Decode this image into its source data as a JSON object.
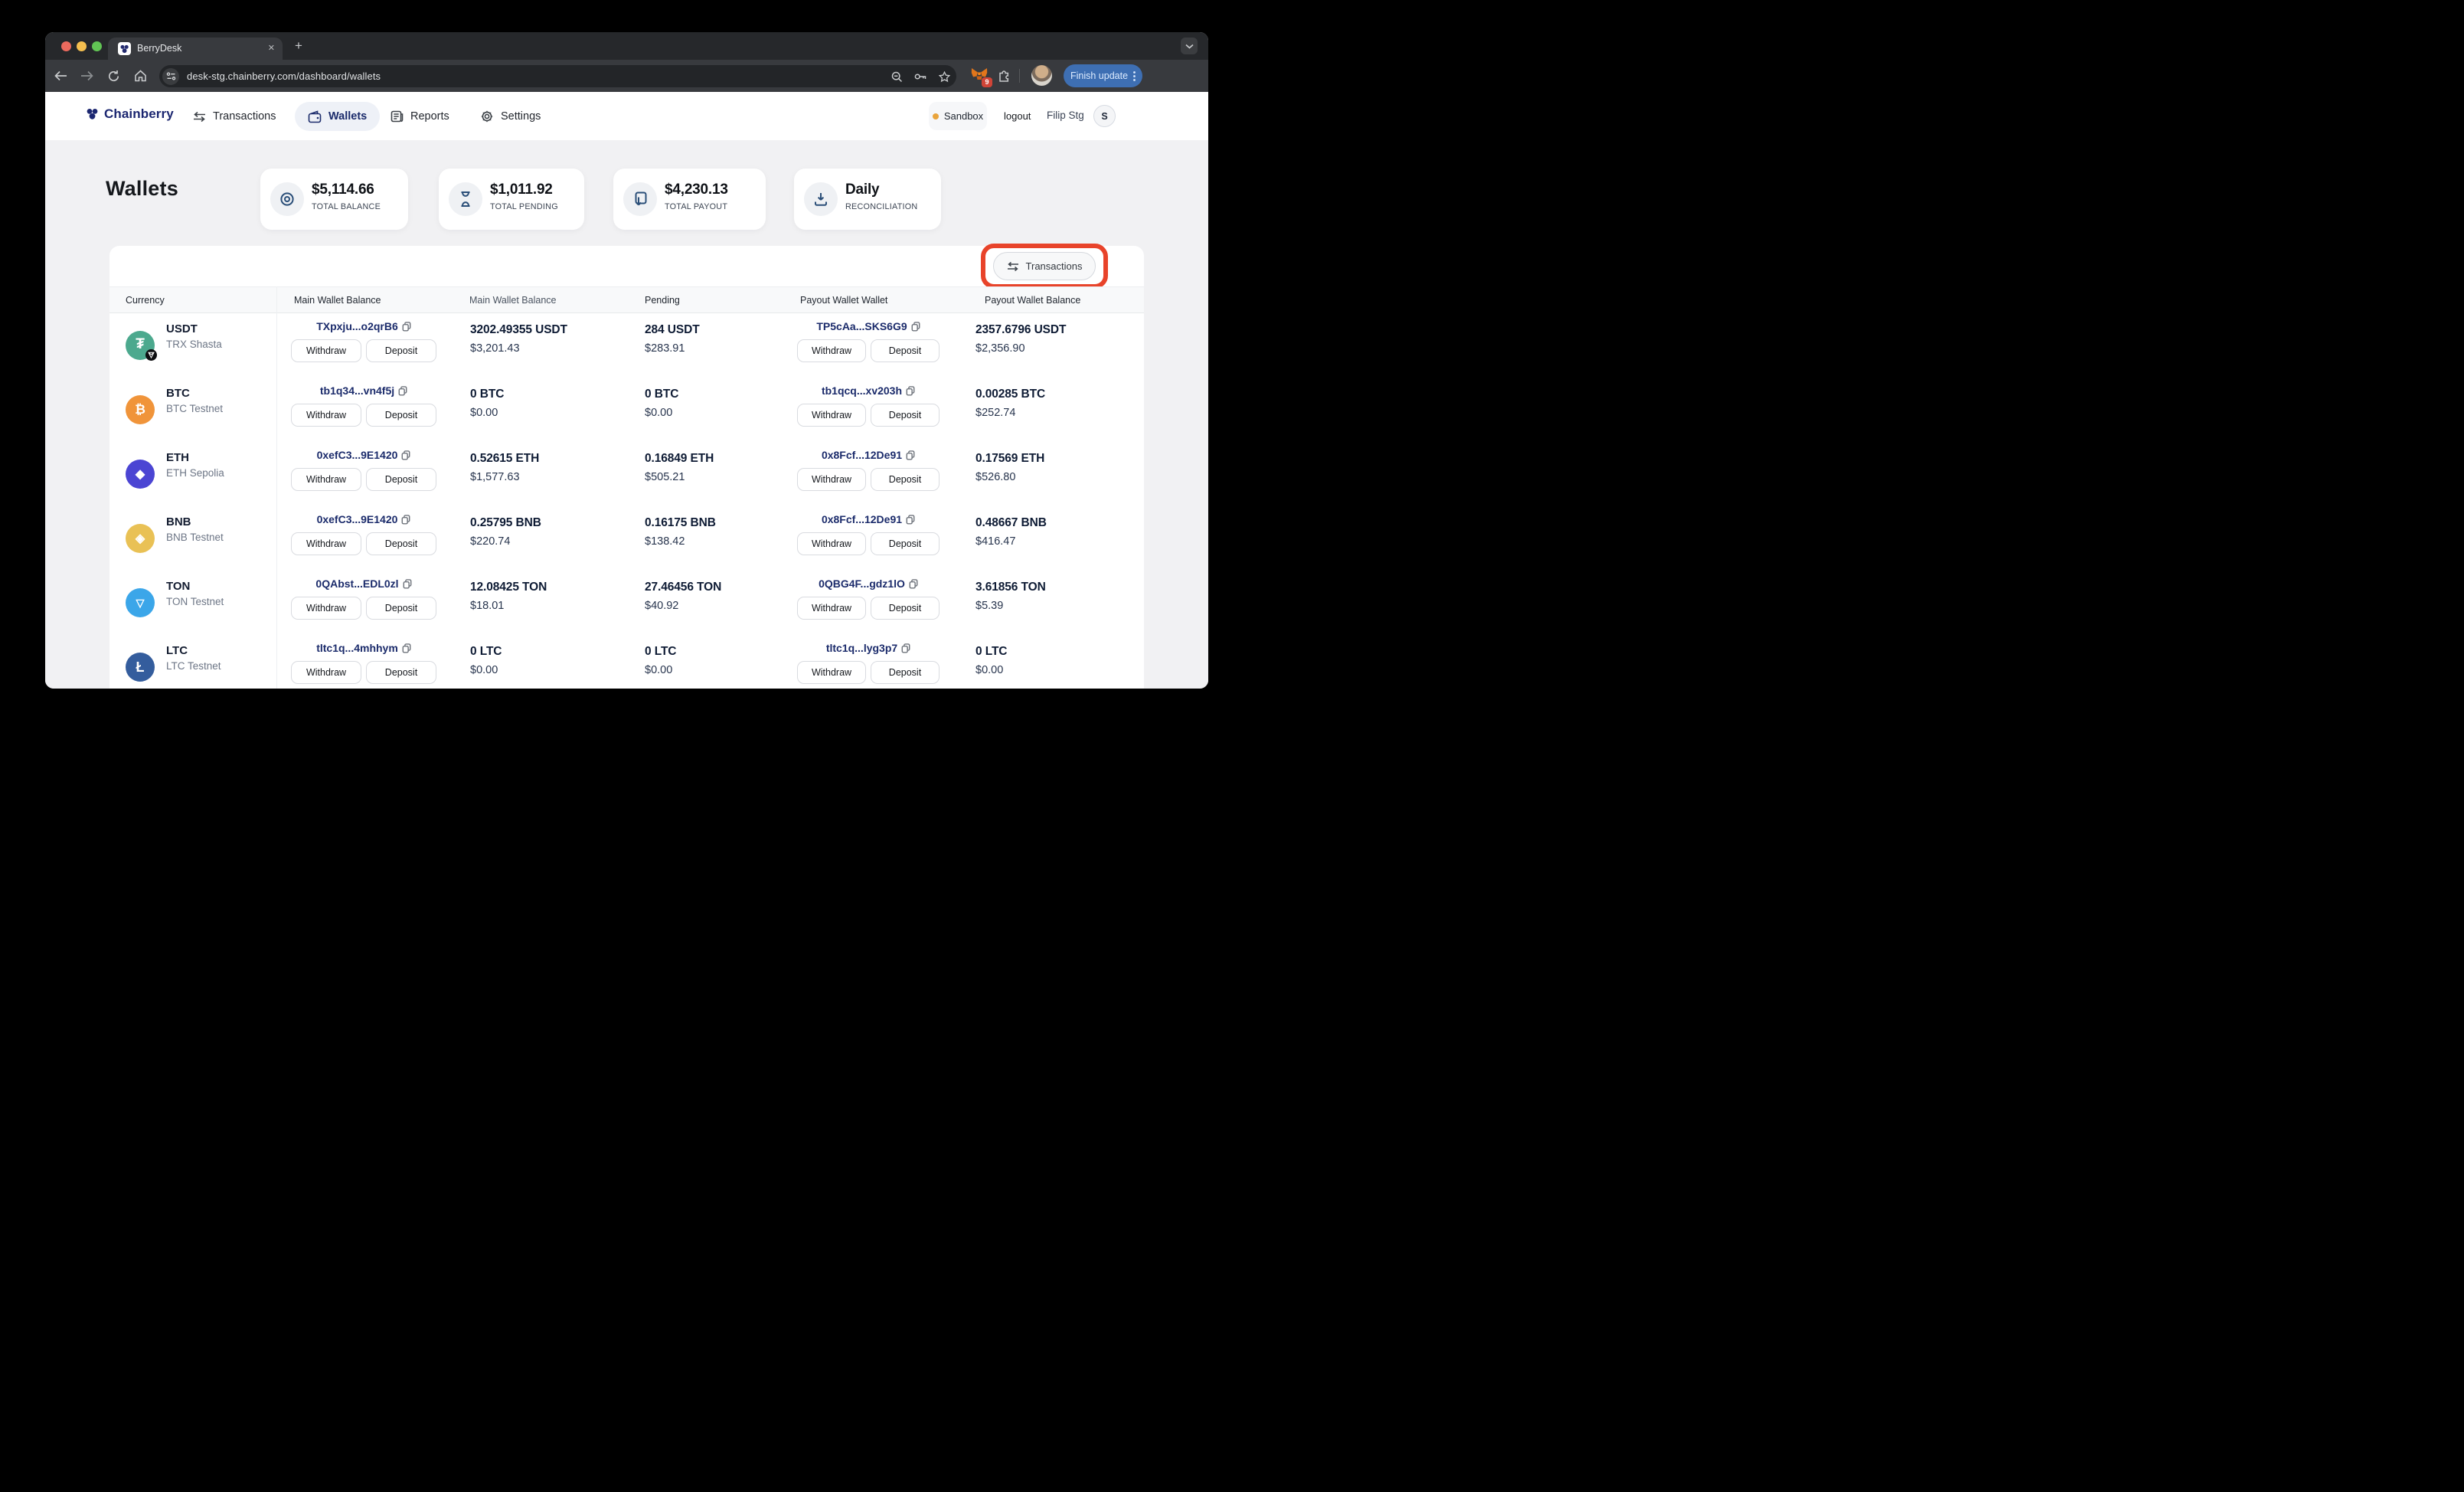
{
  "browser": {
    "tab_title": "BerryDesk",
    "close_glyph": "✕",
    "new_tab_glyph": "+",
    "url": "desk-stg.chainberry.com/dashboard/wallets",
    "extension_badge": "9",
    "update_button": "Finish update"
  },
  "nav": {
    "brand": "Chainberry",
    "items": [
      {
        "label": "Transactions"
      },
      {
        "label": "Wallets"
      },
      {
        "label": "Reports"
      },
      {
        "label": "Settings"
      }
    ],
    "active_item": "Wallets",
    "env_badge": "Sandbox",
    "logout_label": "logout",
    "user_name": "Filip Stg",
    "user_initial": "S"
  },
  "page": {
    "title": "Wallets"
  },
  "summary_cards": [
    {
      "value": "$5,114.66",
      "label": "TOTAL BALANCE",
      "icon": "target-icon"
    },
    {
      "value": "$1,011.92",
      "label": "TOTAL PENDING",
      "icon": "hourglass-icon"
    },
    {
      "value": "$4,230.13",
      "label": "TOTAL PAYOUT",
      "icon": "payout-icon"
    },
    {
      "value": "Daily",
      "label": "RECONCILIATION",
      "icon": "download-icon"
    }
  ],
  "table": {
    "toolbar_button": "Transactions",
    "headers": [
      "Currency",
      "Main Wallet Balance",
      "Main Wallet Balance",
      "Pending",
      "Payout Wallet Wallet",
      "Payout Wallet Balance"
    ],
    "actions": {
      "withdraw": "Withdraw",
      "deposit": "Deposit"
    },
    "rows": [
      {
        "symbol": "USDT",
        "network": "TRX Shasta",
        "glyph": "₮",
        "icon_style": "background:#4CA98E",
        "main_address": "TXpxju...o2qrB6",
        "main_amount": "3202.49355 USDT",
        "main_usd": "$3,201.43",
        "pending_amount": "284 USDT",
        "pending_usd": "$283.91",
        "payout_address": "TP5cAa...SKS6G9",
        "payout_amount": "2357.6796 USDT",
        "payout_usd": "$2,356.90"
      },
      {
        "symbol": "BTC",
        "network": "BTC Testnet",
        "glyph": "₿",
        "icon_style": "background:#F0943A",
        "main_address": "tb1q34...vn4f5j",
        "main_amount": "0 BTC",
        "main_usd": "$0.00",
        "pending_amount": "0 BTC",
        "pending_usd": "$0.00",
        "payout_address": "tb1qcq...xv203h",
        "payout_amount": "0.00285 BTC",
        "payout_usd": "$252.74"
      },
      {
        "symbol": "ETH",
        "network": "ETH Sepolia",
        "glyph": "◆",
        "icon_style": "background:#4B45D3",
        "main_address": "0xefC3...9E1420",
        "main_amount": "0.52615 ETH",
        "main_usd": "$1,577.63",
        "pending_amount": "0.16849 ETH",
        "pending_usd": "$505.21",
        "payout_address": "0x8Fcf...12De91",
        "payout_amount": "0.17569 ETH",
        "payout_usd": "$526.80"
      },
      {
        "symbol": "BNB",
        "network": "BNB Testnet",
        "glyph": "◈",
        "icon_style": "background:#E9C155",
        "main_address": "0xefC3...9E1420",
        "main_amount": "0.25795 BNB",
        "main_usd": "$220.74",
        "pending_amount": "0.16175 BNB",
        "pending_usd": "$138.42",
        "payout_address": "0x8Fcf...12De91",
        "payout_amount": "0.48667 BNB",
        "payout_usd": "$416.47"
      },
      {
        "symbol": "TON",
        "network": "TON Testnet",
        "glyph": "▽",
        "icon_style": "background:#3BA6E9",
        "main_address": "0QAbst...EDL0zl",
        "main_amount": "12.08425 TON",
        "main_usd": "$18.01",
        "pending_amount": "27.46456 TON",
        "pending_usd": "$40.92",
        "payout_address": "0QBG4F...gdz1lO",
        "payout_amount": "3.61856 TON",
        "payout_usd": "$5.39"
      },
      {
        "symbol": "LTC",
        "network": "LTC Testnet",
        "glyph": "Ł",
        "icon_style": "background:#345D9D",
        "main_address": "tltc1q...4mhhym",
        "main_amount": "0 LTC",
        "main_usd": "$0.00",
        "pending_amount": "0 LTC",
        "pending_usd": "$0.00",
        "payout_address": "tltc1q...lyg3p7",
        "payout_amount": "0 LTC",
        "payout_usd": "$0.00"
      }
    ]
  },
  "colors": {
    "annotation_red": "#E8432A",
    "update_blue": "#3E6FB3",
    "sandbox_dot": "#E9A43C",
    "brand_navy": "#1B2B6B"
  }
}
